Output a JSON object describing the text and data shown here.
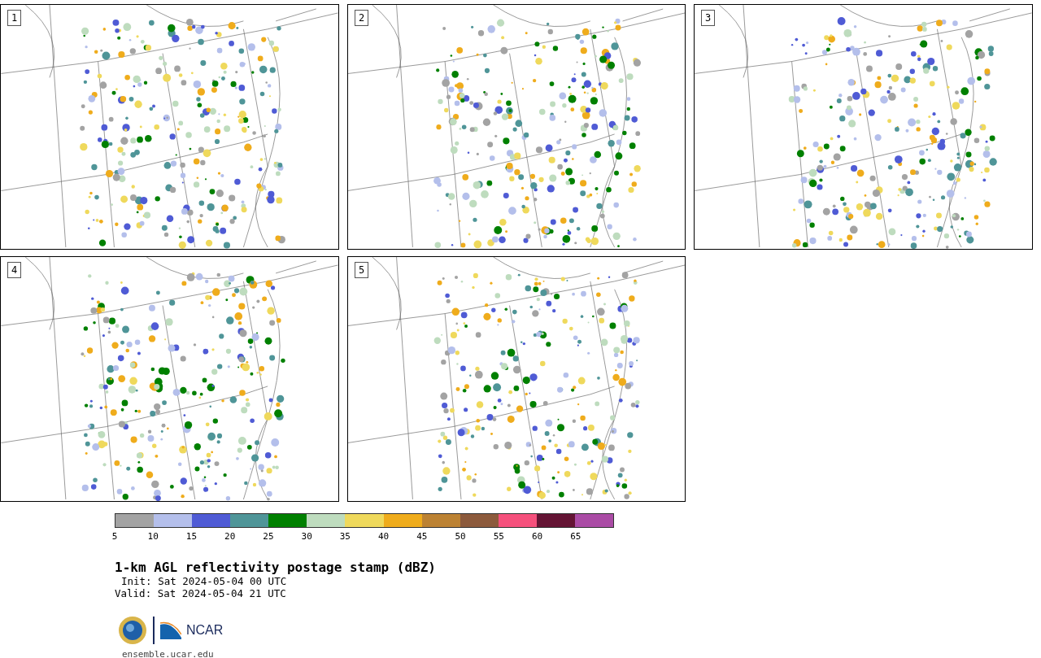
{
  "panels": [
    {
      "label": "1"
    },
    {
      "label": "2"
    },
    {
      "label": "3"
    },
    {
      "label": "4"
    },
    {
      "label": "5"
    }
  ],
  "colorbar": {
    "bins": [
      {
        "color": "#a3a3a3"
      },
      {
        "color": "#b4bfeb"
      },
      {
        "color": "#4f5bd5"
      },
      {
        "color": "#4f9598"
      },
      {
        "color": "#008000"
      },
      {
        "color": "#bedcbe"
      },
      {
        "color": "#efd95c"
      },
      {
        "color": "#efac1c"
      },
      {
        "color": "#bc8233"
      },
      {
        "color": "#8c5a3c"
      },
      {
        "color": "#f5507c"
      },
      {
        "color": "#641434"
      },
      {
        "color": "#aa4ba5"
      }
    ],
    "ticks": [
      "5",
      "10",
      "15",
      "20",
      "25",
      "30",
      "35",
      "40",
      "45",
      "50",
      "55",
      "60",
      "65"
    ]
  },
  "title": "1-km AGL reflectivity postage stamp (dBZ)",
  "init": "Init: Sat 2024-05-04 00 UTC",
  "valid": "Valid: Sat 2024-05-04 21 UTC",
  "logo_text": "NCAR",
  "footer": "ensemble.ucar.edu"
}
